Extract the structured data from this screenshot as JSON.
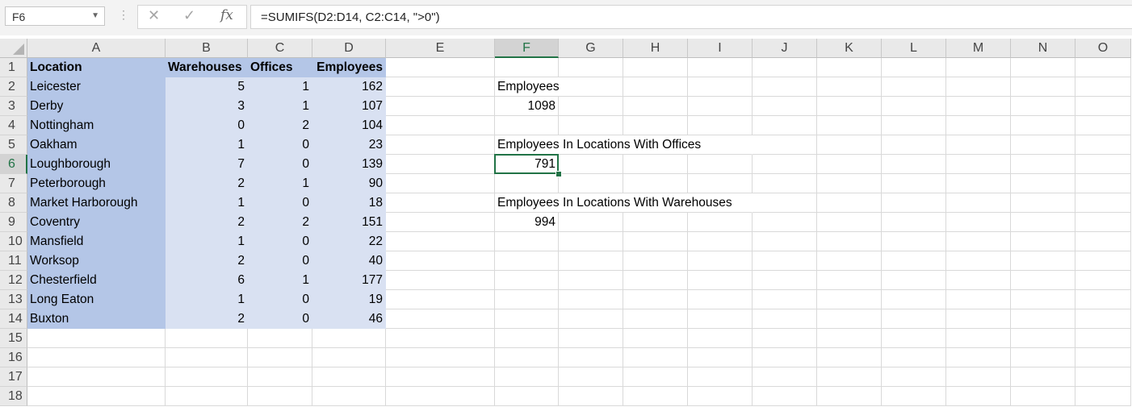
{
  "name_box": {
    "value": "F6",
    "dropdown_icon": "chevron-down-icon"
  },
  "formula_bar": {
    "dots_icon": "more-options-icon",
    "cancel_icon": "close-icon",
    "enter_icon": "checkmark-icon",
    "fx_label": "fx",
    "formula": "=SUMIFS(D2:D14, C2:C14, \">0\")"
  },
  "columns": [
    "A",
    "B",
    "C",
    "D",
    "E",
    "F",
    "G",
    "H",
    "I",
    "J",
    "K",
    "L",
    "M",
    "N",
    "O"
  ],
  "rows": [
    "1",
    "2",
    "3",
    "4",
    "5",
    "6",
    "7",
    "8",
    "9",
    "10",
    "11",
    "12",
    "13",
    "14",
    "15",
    "16",
    "17",
    "18"
  ],
  "selected_cell": {
    "col": "F",
    "row": "6"
  },
  "table": {
    "headers": [
      "Location",
      "Warehouses",
      "Offices",
      "Employees"
    ],
    "rows": [
      [
        "Leicester",
        "5",
        "1",
        "162"
      ],
      [
        "Derby",
        "3",
        "1",
        "107"
      ],
      [
        "Nottingham",
        "0",
        "2",
        "104"
      ],
      [
        "Oakham",
        "1",
        "0",
        "23"
      ],
      [
        "Loughborough",
        "7",
        "0",
        "139"
      ],
      [
        "Peterborough",
        "2",
        "1",
        "90"
      ],
      [
        "Market Harborough",
        "1",
        "0",
        "18"
      ],
      [
        "Coventry",
        "2",
        "2",
        "151"
      ],
      [
        "Mansfield",
        "1",
        "0",
        "22"
      ],
      [
        "Worksop",
        "2",
        "0",
        "40"
      ],
      [
        "Chesterfield",
        "6",
        "1",
        "177"
      ],
      [
        "Long Eaton",
        "1",
        "0",
        "19"
      ],
      [
        "Buxton",
        "2",
        "0",
        "46"
      ]
    ]
  },
  "summary": {
    "employees_label": "Employees",
    "employees_value": "1098",
    "offices_label": "Employees In Locations With Offices",
    "offices_value": "791",
    "warehouses_label": "Employees In Locations With Warehouses",
    "warehouses_value": "994"
  },
  "colors": {
    "location_fill": "#b4c6e7",
    "data_fill": "#d9e1f2",
    "accent": "#217346"
  }
}
